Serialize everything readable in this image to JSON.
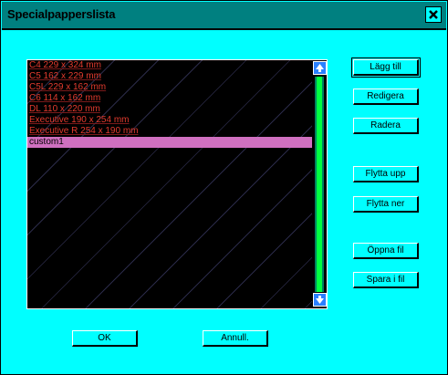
{
  "window": {
    "title": "Specialpapperslista"
  },
  "list": {
    "items": [
      "C4 229 x 324 mm",
      "C5 162 x 229 mm",
      "C5L 229 x 162 mm",
      "C6 114 x 162 mm",
      "DL 110 x 220 mm",
      "Executive 190 x 254 mm",
      "Executive R 254 x 190 mm",
      "custom1"
    ],
    "selected_index": 7
  },
  "buttons": {
    "add": "Lägg till",
    "edit": "Redigera",
    "delete": "Radera",
    "move_up": "Flytta upp",
    "move_down": "Flytta ner",
    "open_file": "Öppna fil",
    "save_file": "Spara i fil",
    "ok": "OK",
    "cancel": "Annull."
  },
  "colors": {
    "dialog_background": "#00ffff",
    "titlebar": "#008080",
    "list_item_text": "#e33b2e",
    "selection": "#d070c0",
    "scroll_track": "#00ff40",
    "scroll_arrows": "#2a80ff"
  },
  "icons": {
    "close": "close-icon",
    "scroll_up": "scroll-up-arrow-icon",
    "scroll_down": "scroll-down-arrow-icon"
  }
}
